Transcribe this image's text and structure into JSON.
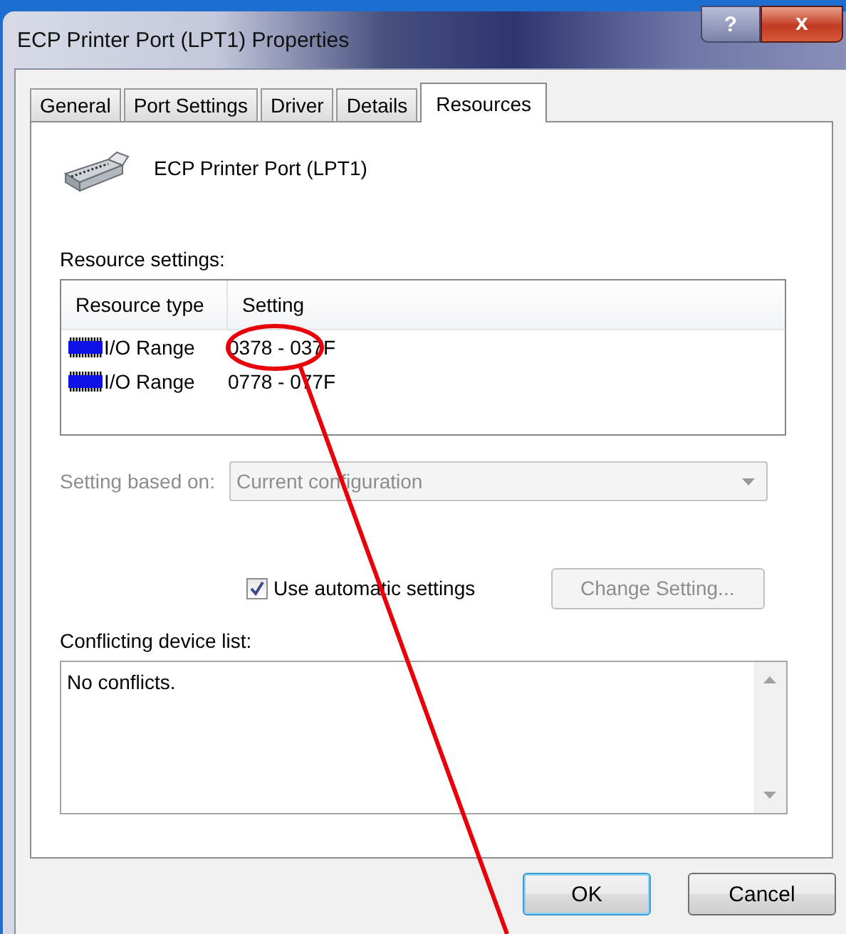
{
  "window": {
    "title": "ECP Printer Port (LPT1) Properties",
    "help_button": "?",
    "close_button": "x"
  },
  "tabs": [
    {
      "label": "General",
      "selected": false
    },
    {
      "label": "Port Settings",
      "selected": false
    },
    {
      "label": "Driver",
      "selected": false
    },
    {
      "label": "Details",
      "selected": false
    },
    {
      "label": "Resources",
      "selected": true
    }
  ],
  "device_name": "ECP Printer Port (LPT1)",
  "resource_settings": {
    "label": "Resource settings:",
    "columns": [
      "Resource type",
      "Setting"
    ],
    "rows": [
      {
        "type": "I/O Range",
        "setting": "0378 - 037F"
      },
      {
        "type": "I/O Range",
        "setting": "0778 - 077F"
      }
    ]
  },
  "setting_based_on": {
    "label": "Setting based on:",
    "value": "Current configuration",
    "disabled": true
  },
  "use_automatic": {
    "label": "Use automatic settings",
    "checked": true
  },
  "change_setting": {
    "label": "Change Setting...",
    "disabled": true
  },
  "conflicts": {
    "label": "Conflicting device list:",
    "text": "No conflicts."
  },
  "buttons": [
    {
      "label": "OK",
      "default": true
    },
    {
      "label": "Cancel",
      "default": false
    }
  ]
}
